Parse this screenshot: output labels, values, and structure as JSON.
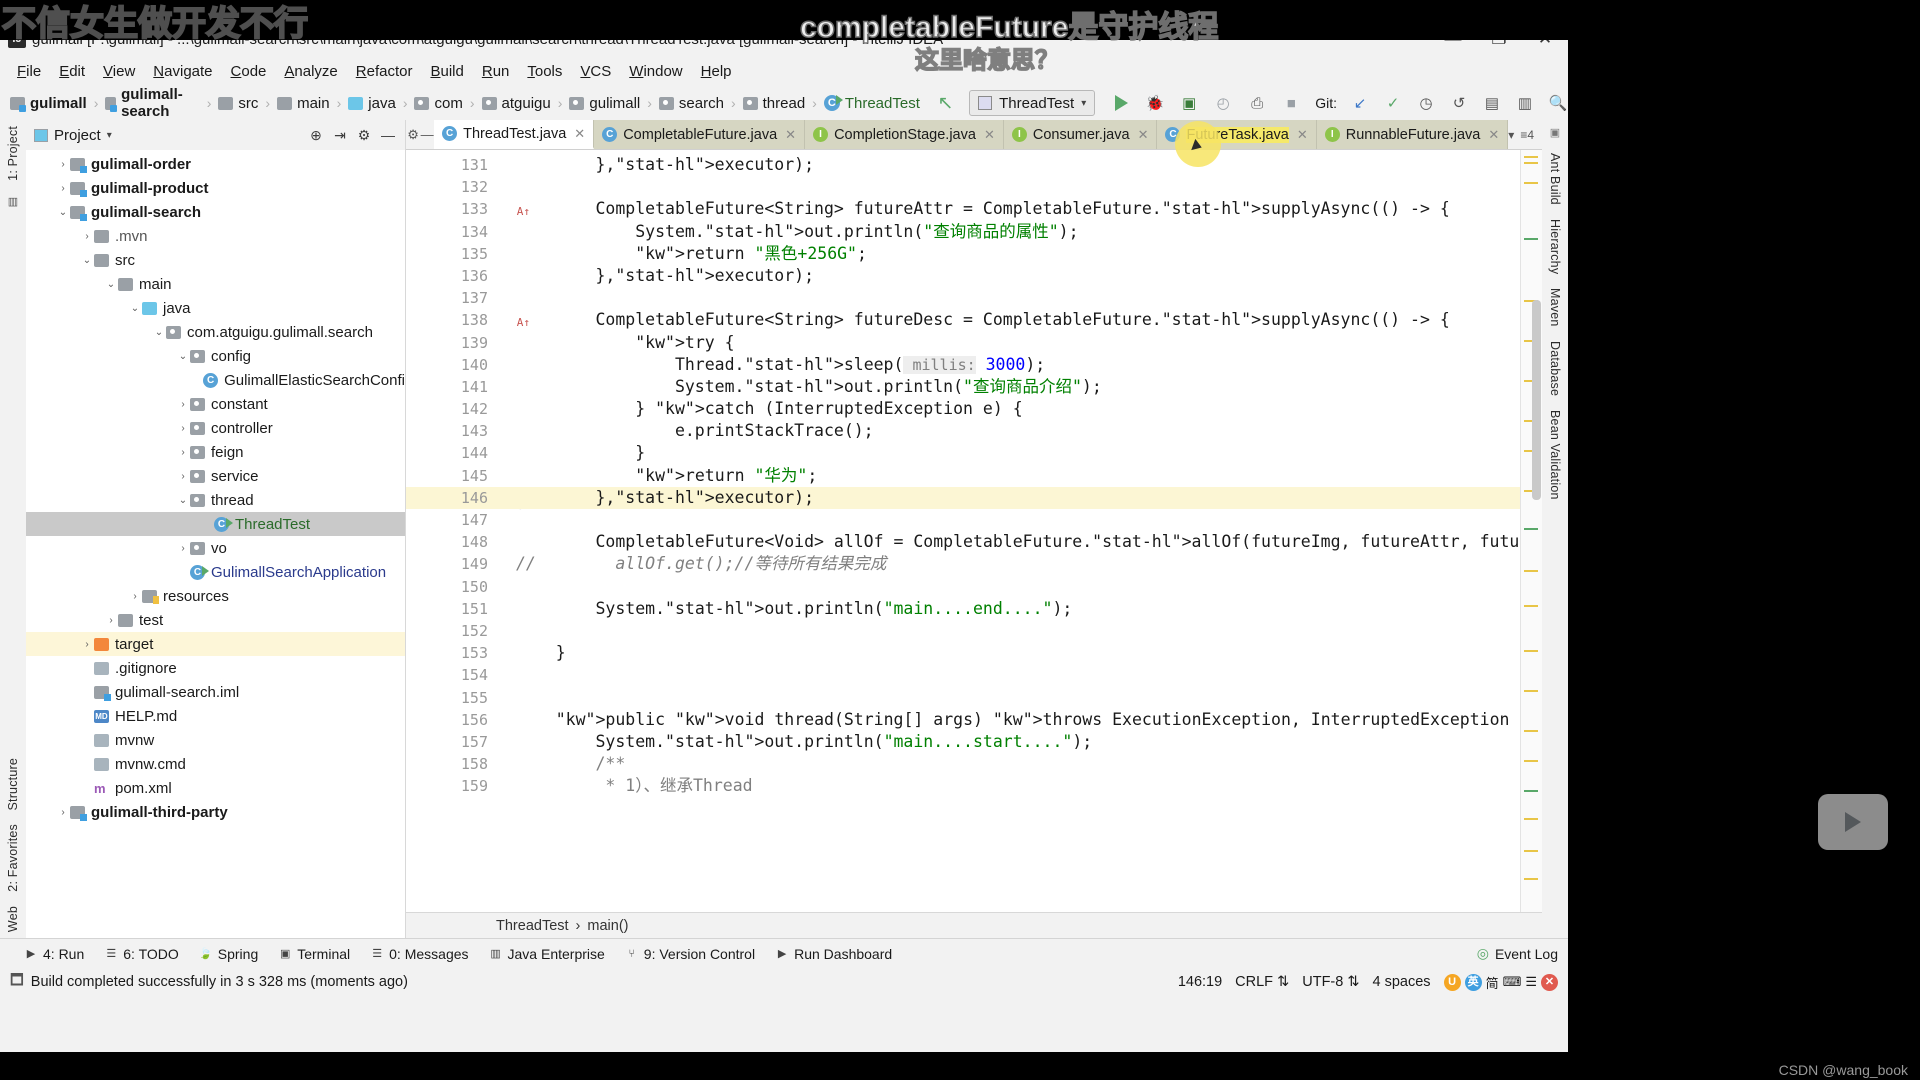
{
  "overlay": {
    "danmaku_left": "不信女生做开发不行",
    "danmaku_top": "completableFuture是守护线程",
    "danmaku_bottom": "这里啥意思？",
    "watermark": "CSDN @wang_book"
  },
  "titlebar": {
    "text": "gulimall [F:\\gulimall] - ...\\gulimall-search\\src\\main\\java\\com\\atguigu\\gulimall\\search\\thread\\ThreadTest.java [gulimall-search] - IntelliJ IDEA",
    "app_icon": "IJ",
    "minimize": "—",
    "maximize": "❐",
    "close": "✕"
  },
  "menubar": {
    "items": [
      "File",
      "Edit",
      "View",
      "Navigate",
      "Code",
      "Analyze",
      "Refactor",
      "Build",
      "Run",
      "Tools",
      "VCS",
      "Window",
      "Help"
    ]
  },
  "navbar": {
    "crumbs": [
      {
        "label": "gulimall",
        "icon": "module-icon",
        "bold": true
      },
      {
        "label": "gulimall-search",
        "icon": "module-icon",
        "bold": true
      },
      {
        "label": "src",
        "icon": "folder-icon",
        "bold": false
      },
      {
        "label": "main",
        "icon": "folder-icon",
        "bold": false
      },
      {
        "label": "java",
        "icon": "source-root-icon",
        "bold": false
      },
      {
        "label": "com",
        "icon": "package-icon",
        "bold": false
      },
      {
        "label": "atguigu",
        "icon": "package-icon",
        "bold": false
      },
      {
        "label": "gulimall",
        "icon": "package-icon",
        "bold": false
      },
      {
        "label": "search",
        "icon": "package-icon",
        "bold": false
      },
      {
        "label": "thread",
        "icon": "package-icon",
        "bold": false
      },
      {
        "label": "ThreadTest",
        "icon": "class-runnable-icon",
        "bold": false
      }
    ],
    "back_arrow": "↖",
    "run_config": "ThreadTest",
    "git_label": "Git:"
  },
  "project_panel": {
    "title": "Project",
    "title_caret": "▾",
    "tree": [
      {
        "depth": 1,
        "arrow": "›",
        "icon": "module-icon",
        "label": "gulimall-order",
        "style": "bold"
      },
      {
        "depth": 1,
        "arrow": "›",
        "icon": "module-icon",
        "label": "gulimall-product",
        "style": "bold"
      },
      {
        "depth": 1,
        "arrow": "⌄",
        "icon": "module-icon",
        "label": "gulimall-search",
        "style": "bold"
      },
      {
        "depth": 2,
        "arrow": "›",
        "icon": "folder-icon",
        "label": ".mvn",
        "style": "grey"
      },
      {
        "depth": 2,
        "arrow": "⌄",
        "icon": "folder-icon",
        "label": "src",
        "style": ""
      },
      {
        "depth": 3,
        "arrow": "⌄",
        "icon": "folder-icon",
        "label": "main",
        "style": ""
      },
      {
        "depth": 4,
        "arrow": "⌄",
        "icon": "source-root-icon",
        "label": "java",
        "style": ""
      },
      {
        "depth": 5,
        "arrow": "⌄",
        "icon": "package-icon",
        "label": "com.atguigu.gulimall.search",
        "style": ""
      },
      {
        "depth": 6,
        "arrow": "⌄",
        "icon": "package-icon",
        "label": "config",
        "style": ""
      },
      {
        "depth": 7,
        "arrow": "",
        "icon": "class-icon",
        "label": "GulimallElasticSearchConfi",
        "style": ""
      },
      {
        "depth": 6,
        "arrow": "›",
        "icon": "package-icon",
        "label": "constant",
        "style": ""
      },
      {
        "depth": 6,
        "arrow": "›",
        "icon": "package-icon",
        "label": "controller",
        "style": ""
      },
      {
        "depth": 6,
        "arrow": "›",
        "icon": "package-icon",
        "label": "feign",
        "style": ""
      },
      {
        "depth": 6,
        "arrow": "›",
        "icon": "package-icon",
        "label": "service",
        "style": ""
      },
      {
        "depth": 6,
        "arrow": "⌄",
        "icon": "package-icon",
        "label": "thread",
        "style": ""
      },
      {
        "depth": 7,
        "arrow": "",
        "icon": "class-runnable-icon",
        "label": "ThreadTest",
        "style": "green",
        "selected": true
      },
      {
        "depth": 6,
        "arrow": "›",
        "icon": "package-icon",
        "label": "vo",
        "style": ""
      },
      {
        "depth": 6,
        "arrow": "",
        "icon": "class-runnable-icon",
        "label": "GulimallSearchApplication",
        "style": "blue"
      },
      {
        "depth": 4,
        "arrow": "›",
        "icon": "resources-icon",
        "label": "resources",
        "style": ""
      },
      {
        "depth": 3,
        "arrow": "›",
        "icon": "folder-icon",
        "label": "test",
        "style": ""
      },
      {
        "depth": 2,
        "arrow": "›",
        "icon": "target-icon",
        "label": "target",
        "style": "",
        "highlight": true
      },
      {
        "depth": 2,
        "arrow": "",
        "icon": "file-icon",
        "label": ".gitignore",
        "style": ""
      },
      {
        "depth": 2,
        "arrow": "",
        "icon": "iml-icon",
        "label": "gulimall-search.iml",
        "style": ""
      },
      {
        "depth": 2,
        "arrow": "",
        "icon": "md-icon",
        "label": "HELP.md",
        "style": ""
      },
      {
        "depth": 2,
        "arrow": "",
        "icon": "file-icon",
        "label": "mvnw",
        "style": ""
      },
      {
        "depth": 2,
        "arrow": "",
        "icon": "file-icon",
        "label": "mvnw.cmd",
        "style": ""
      },
      {
        "depth": 2,
        "arrow": "",
        "icon": "pom-icon",
        "label": "pom.xml",
        "style": ""
      },
      {
        "depth": 1,
        "arrow": "›",
        "icon": "module-icon",
        "label": "gulimall-third-party",
        "style": "bold"
      }
    ]
  },
  "left_toolbar": {
    "top": "1: Project",
    "bottom": [
      "2: Favorites",
      "Web",
      "Structure"
    ]
  },
  "right_toolbar": {
    "items": [
      "Ant Build",
      "Hierarchy",
      "Maven",
      "Database",
      "Bean Validation"
    ]
  },
  "editor_tabs": [
    {
      "label": "ThreadTest.java",
      "icon": "class-runnable-icon",
      "active": true,
      "close": "✕"
    },
    {
      "label": "CompletableFuture.java",
      "icon": "class-icon",
      "active": false,
      "close": "✕"
    },
    {
      "label": "CompletionStage.java",
      "icon": "interface-icon",
      "active": false,
      "close": "✕"
    },
    {
      "label": "Consumer.java",
      "icon": "interface-icon",
      "active": false,
      "close": "✕"
    },
    {
      "label": "FutureTask.java",
      "icon": "class-icon",
      "active": false,
      "close": "✕",
      "highlighted": true
    },
    {
      "label": "RunnableFuture.java",
      "icon": "interface-icon",
      "active": false,
      "close": "✕"
    }
  ],
  "code": {
    "first_line": 131,
    "highlight_line": 146,
    "lines": [
      {
        "n": 131,
        "html": "        },<i>executor</i>);"
      },
      {
        "n": 132,
        "html": ""
      },
      {
        "n": 133,
        "html": "        CompletableFuture&lt;String&gt; futureAttr = CompletableFuture.<i>supplyAsync</i>(() -&gt; {",
        "mark": "warn"
      },
      {
        "n": 134,
        "html": "            System.<i>out</i>.println(\"查询商品的属性\");"
      },
      {
        "n": 135,
        "html": "            <b>return</b> \"黑色+256G\";"
      },
      {
        "n": 136,
        "html": "        },<i>executor</i>);"
      },
      {
        "n": 137,
        "html": ""
      },
      {
        "n": 138,
        "html": "        CompletableFuture&lt;String&gt; futureDesc = CompletableFuture.<i>supplyAsync</i>(() -&gt; {",
        "mark": "warn"
      },
      {
        "n": 139,
        "html": "            <b>try</b> {"
      },
      {
        "n": 140,
        "html": "                Thread.<i>sleep</i>( millis: 3000);"
      },
      {
        "n": 141,
        "html": "                System.<i>out</i>.println(\"查询商品介绍\");"
      },
      {
        "n": 142,
        "html": "            } <b>catch</b> (InterruptedException e) {"
      },
      {
        "n": 143,
        "html": "                e.printStackTrace();"
      },
      {
        "n": 144,
        "html": "            }"
      },
      {
        "n": 145,
        "html": "            <b>return</b> \"华为\";"
      },
      {
        "n": 146,
        "html": "        },<i>executor</i>);",
        "mark": "bulb",
        "highlight": true
      },
      {
        "n": 147,
        "html": ""
      },
      {
        "n": 148,
        "html": "        CompletableFuture&lt;Void&gt; allOf = CompletableFuture.<i>allOf</i>(futureImg, futureAttr, futureDesc);"
      },
      {
        "n": 149,
        "html": "//        allOf.get();//等待所有结果完成"
      },
      {
        "n": 150,
        "html": ""
      },
      {
        "n": 151,
        "html": "        System.<i>out</i>.println(\"main....end....\");"
      },
      {
        "n": 152,
        "html": ""
      },
      {
        "n": 153,
        "html": "    }"
      },
      {
        "n": 154,
        "html": ""
      },
      {
        "n": 155,
        "html": ""
      },
      {
        "n": 156,
        "html": "    <b>public</b> <b>void</b> thread(String[] args) <b>throws</b> ExecutionException, InterruptedException {"
      },
      {
        "n": 157,
        "html": "        System.<i>out</i>.println(\"main....start....\");"
      },
      {
        "n": 158,
        "html": "        /**"
      },
      {
        "n": 159,
        "html": "         * 1）、继承Thread"
      }
    ]
  },
  "breadcrumb_bar": {
    "class": "ThreadTest",
    "method": "main()",
    "sep": "›"
  },
  "tool_windows": [
    {
      "label": "4: Run",
      "icon": "run-icon"
    },
    {
      "label": "6: TODO",
      "icon": "todo-icon"
    },
    {
      "label": "Spring",
      "icon": "spring-icon"
    },
    {
      "label": "Terminal",
      "icon": "terminal-icon"
    },
    {
      "label": "0: Messages",
      "icon": "messages-icon"
    },
    {
      "label": "Java Enterprise",
      "icon": "java-enterprise-icon"
    },
    {
      "label": "9: Version Control",
      "icon": "version-control-icon"
    },
    {
      "label": "Run Dashboard",
      "icon": "run-dashboard-icon"
    }
  ],
  "event_log": {
    "label": "Event Log",
    "icon": "event-log-icon"
  },
  "statusbar": {
    "message": "Build completed successfully in 3 s 328 ms (moments ago)",
    "caret": "146:19",
    "line_sep": "CRLF",
    "encoding": "UTF-8",
    "indent": "4 spaces",
    "ime_lang": "英",
    "ime_icons": [
      "●",
      "简",
      "⌨",
      "☰",
      "✕"
    ]
  },
  "colors": {
    "accent_green": "#59a869",
    "selection": "#c9c9c9",
    "line_highlight": "#fcf6d4",
    "tab_inactive": "#d6d6c2",
    "keyword": "#000080",
    "string": "#008000",
    "static_field": "#660e7a"
  }
}
